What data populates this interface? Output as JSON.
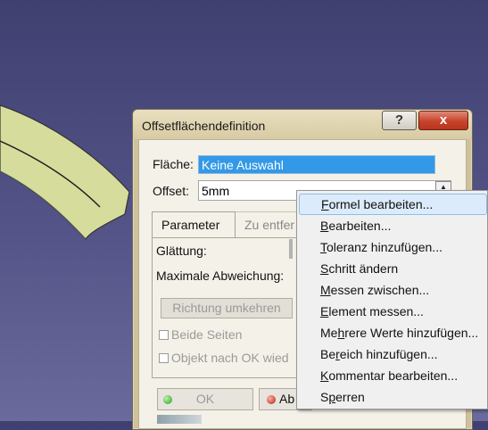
{
  "window": {
    "title": "Offsetflächendefinition",
    "help_icon": "?",
    "close_icon": "x"
  },
  "form": {
    "flaeche_label": "Fläche:",
    "flaeche_value": "Keine Auswahl",
    "offset_label": "Offset:",
    "offset_value": "5mm"
  },
  "tabs": [
    {
      "label": "Parameter",
      "active": true
    },
    {
      "label": "Zu entfer",
      "active": false
    }
  ],
  "params": {
    "glaettung_label": "Glättung:",
    "abweichung_label": "Maximale Abweichung:",
    "richtung_button": "Richtung umkehren",
    "beide_seiten": "Beide Seiten",
    "objekt_nach_ok": "Objekt nach OK wied"
  },
  "buttons": {
    "ok": "OK",
    "cancel": "Ab"
  },
  "context_menu": {
    "items": [
      {
        "pre": "",
        "u": "F",
        "post": "ormel bearbeiten...",
        "highlighted": true
      },
      {
        "pre": "",
        "u": "B",
        "post": "earbeiten...",
        "highlighted": false
      },
      {
        "pre": "",
        "u": "T",
        "post": "oleranz hinzufügen...",
        "highlighted": false
      },
      {
        "pre": "",
        "u": "S",
        "post": "chritt ändern",
        "highlighted": false
      },
      {
        "pre": "",
        "u": "M",
        "post": "essen zwischen...",
        "highlighted": false
      },
      {
        "pre": "",
        "u": "E",
        "post": "lement messen...",
        "highlighted": false
      },
      {
        "pre": "Me",
        "u": "h",
        "post": "rere Werte hinzufügen...",
        "highlighted": false
      },
      {
        "pre": "Be",
        "u": "r",
        "post": "eich hinzufügen...",
        "highlighted": false
      },
      {
        "pre": "",
        "u": "K",
        "post": "ommentar bearbeiten...",
        "highlighted": false
      },
      {
        "pre": "S",
        "u": "p",
        "post": "erren",
        "highlighted": false
      }
    ]
  },
  "colors": {
    "background": "#545488",
    "selection_blue": "#3399e6",
    "dialog_frame": "#cfc29a",
    "model_surface": "#d8dfa0"
  }
}
